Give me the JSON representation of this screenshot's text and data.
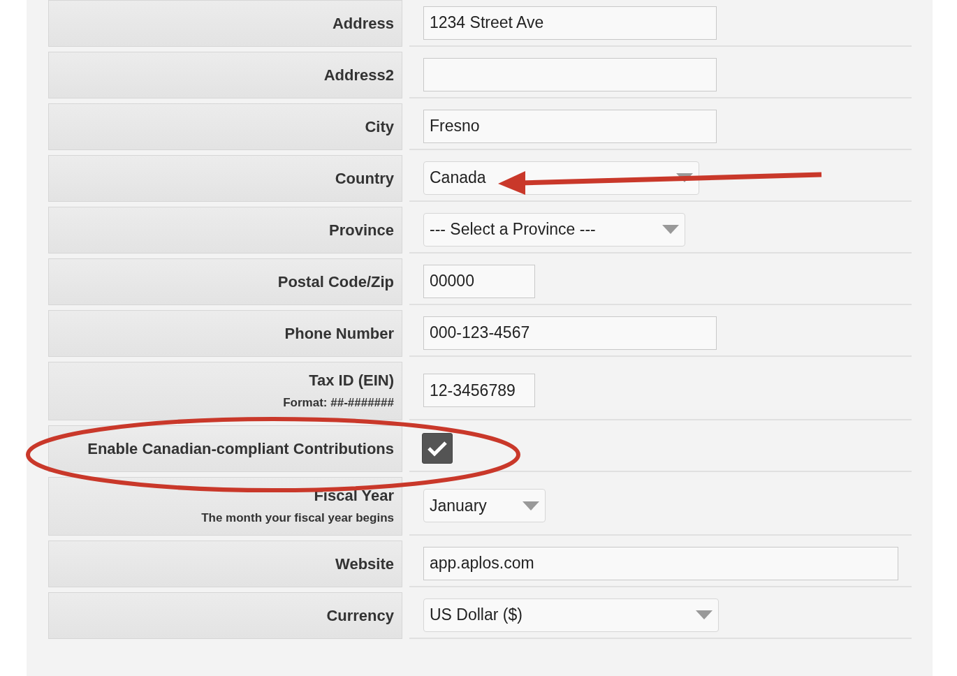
{
  "rows": [
    {
      "label": "Address",
      "kind": "text",
      "value": "1234 Street Ave"
    },
    {
      "label": "Address2",
      "kind": "text",
      "value": ""
    },
    {
      "label": "City",
      "kind": "text",
      "value": "Fresno"
    },
    {
      "label": "Country",
      "kind": "select",
      "value": "Canada"
    },
    {
      "label": "Province",
      "kind": "select",
      "value": "--- Select a Province ---"
    },
    {
      "label": "Postal Code/Zip",
      "kind": "text",
      "value": "00000"
    },
    {
      "label": "Phone Number",
      "kind": "text",
      "value": "000-123-4567"
    },
    {
      "label": "Tax ID (EIN)",
      "hint": "Format: ##-#######",
      "kind": "text",
      "value": "12-3456789"
    },
    {
      "label": "Enable Canadian-compliant Contributions",
      "kind": "checkbox",
      "checked": true
    },
    {
      "label": "Fiscal Year",
      "hint": "The month your fiscal year begins",
      "kind": "select",
      "value": "January"
    },
    {
      "label": "Website",
      "kind": "text",
      "value": "app.aplos.com"
    },
    {
      "label": "Currency",
      "kind": "select",
      "value": "US Dollar ($)"
    }
  ]
}
